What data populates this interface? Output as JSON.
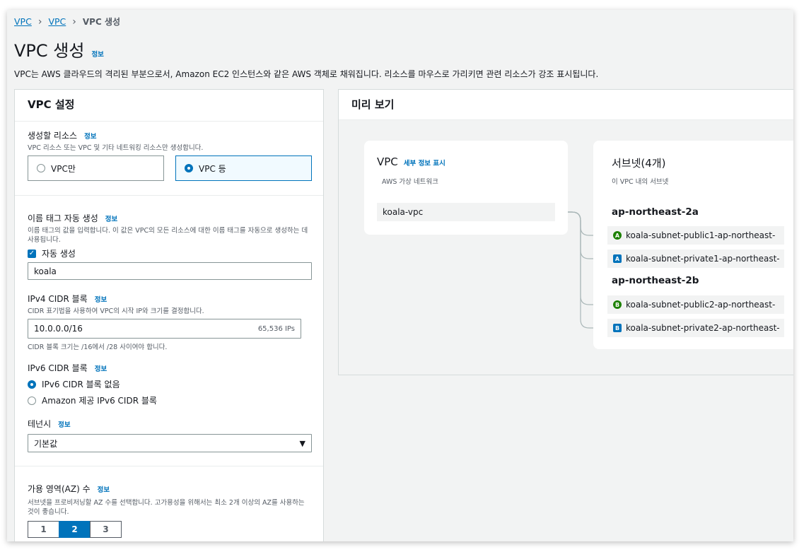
{
  "breadcrumb": {
    "item1": "VPC",
    "item2": "VPC",
    "current": "VPC 생성"
  },
  "page": {
    "title": "VPC 생성",
    "info": "정보",
    "description": "VPC는 AWS 클라우드의 격리된 부분으로서, Amazon EC2 인스턴스와 같은 AWS 객체로 채워집니다. 리소스를 마우스로 가리키면 관련 리소스가 강조 표시됩니다."
  },
  "settings": {
    "heading": "VPC 설정",
    "resources": {
      "label": "생성할 리소스",
      "info": "정보",
      "hint": "VPC 리소스 또는 VPC 및 기타 네트워킹 리소스만 생성합니다.",
      "options": [
        "VPC만",
        "VPC 등"
      ],
      "selected": "VPC 등"
    },
    "name_tag": {
      "label": "이름 태그 자동 생성",
      "info": "정보",
      "hint": "이름 태그의 값을 입력합니다. 이 값은 VPC의 모든 리소스에 대한 이름 태그를 자동으로 생성하는 데 사용됩니다.",
      "checkbox_label": "자동 생성",
      "checked": true,
      "value": "koala"
    },
    "ipv4": {
      "label": "IPv4 CIDR 블록",
      "info": "정보",
      "hint": "CIDR 표기법을 사용하여 VPC의 시작 IP와 크기를 결정합니다.",
      "value": "10.0.0.0/16",
      "suffix": "65,536 IPs",
      "footnote": "CIDR 블록 크기는 /16에서 /28 사이여야 합니다."
    },
    "ipv6": {
      "label": "IPv6 CIDR 블록",
      "info": "정보",
      "options": [
        "IPv6 CIDR 블록 없음",
        "Amazon 제공 IPv6 CIDR 블록"
      ],
      "selected": "IPv6 CIDR 블록 없음"
    },
    "tenancy": {
      "label": "테넌시",
      "info": "정보",
      "value": "기본값"
    },
    "az": {
      "label": "가용 영역(AZ) 수",
      "info": "정보",
      "hint": "서브넷을 프로비저닝할 AZ 수를 선택합니다. 고가용성을 위해서는 최소 2개 이상의 AZ를 사용하는 것이 좋습니다.",
      "options": [
        "1",
        "2",
        "3"
      ],
      "selected": "2"
    }
  },
  "preview": {
    "heading": "미리 보기",
    "vpc_card": {
      "title": "VPC",
      "link": "세부 정보 표시",
      "subtitle": "AWS 가상 네트워크",
      "item": "koala-vpc"
    },
    "subnet_card": {
      "title": "서브넷(4개)",
      "subtitle": "이 VPC 내의 서브넷",
      "groups": [
        {
          "az": "ap-northeast-2a",
          "subnets": [
            {
              "badge": "A",
              "kind": "public",
              "name": "koala-subnet-public1-ap-northeast-"
            },
            {
              "badge": "A",
              "kind": "private",
              "name": "koala-subnet-private1-ap-northeast-"
            }
          ]
        },
        {
          "az": "ap-northeast-2b",
          "subnets": [
            {
              "badge": "B",
              "kind": "public",
              "name": "koala-subnet-public2-ap-northeast-"
            },
            {
              "badge": "B",
              "kind": "private",
              "name": "koala-subnet-private2-ap-northeast-"
            }
          ]
        }
      ]
    }
  },
  "colors": {
    "accent": "#0073bb",
    "public_badge": "#1d8102",
    "background": "#f2f3f3"
  }
}
